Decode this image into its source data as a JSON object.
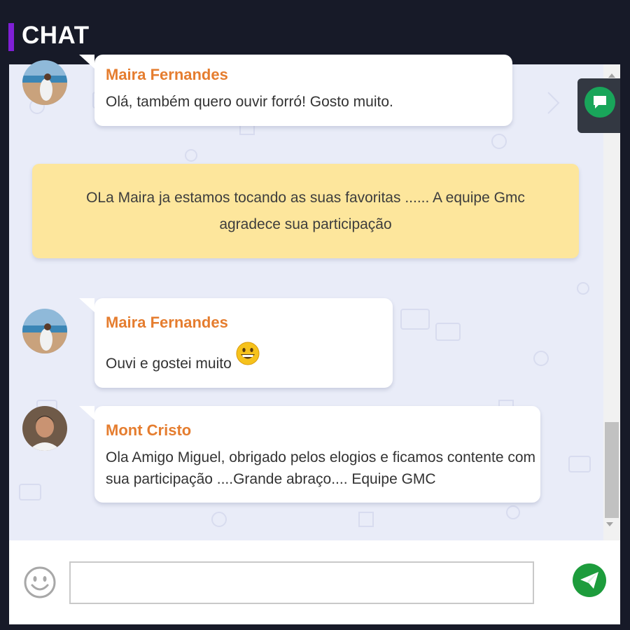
{
  "header": {
    "title": "CHAT"
  },
  "messages": [
    {
      "sender": "Maira Fernandes",
      "lines": [
        "Olá, também quero ouvir forró! Gosto muito."
      ],
      "avatar": "beach-avatar"
    },
    {
      "system": true,
      "lines": [
        "OLa Maira ja estamos tocando as suas favoritas ...... A equipe Gmc",
        "agradece sua participação"
      ]
    },
    {
      "sender": "Maira Fernandes",
      "lines": [
        "Ouvi e gostei muito"
      ],
      "emoji": "grinning-face",
      "avatar": "beach-avatar"
    },
    {
      "sender": "Mont Cristo",
      "lines": [
        "Ola Amigo Miguel, obrigado pelos elogios e ficamos contente com",
        "sua participação ....Grande abraço.... Equipe GMC"
      ],
      "avatar": "man-avatar"
    }
  ],
  "composer": {
    "value": "",
    "placeholder": ""
  },
  "icons": {
    "fab": "chat-bubble-icon",
    "emoji_button": "smiley-icon",
    "send": "paper-plane-icon"
  },
  "colors": {
    "accent": "#7f1fd6",
    "sender_name": "#e57d2f",
    "system_bubble": "#fde69c",
    "send_button": "#1d9c3c",
    "fab": "#19a55a"
  }
}
